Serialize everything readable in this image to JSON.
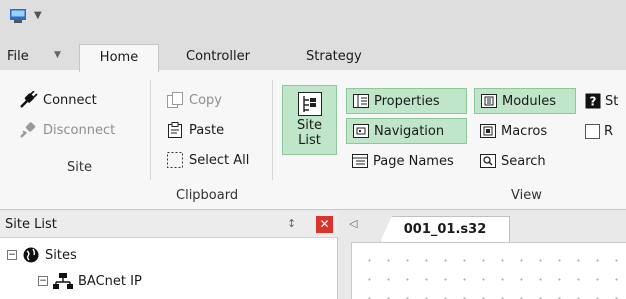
{
  "menu": {
    "file_label": "File",
    "tabs": [
      "Home",
      "Controller",
      "Strategy"
    ]
  },
  "ribbon": {
    "site": {
      "connect": "Connect",
      "disconnect": "Disconnect",
      "label": "Site"
    },
    "clipboard": {
      "copy": "Copy",
      "paste": "Paste",
      "select_all": "Select All",
      "label": "Clipboard"
    },
    "view": {
      "site_list": [
        "Site",
        "List"
      ],
      "properties": "Properties",
      "navigation": "Navigation",
      "page_names": "Page Names",
      "modules": "Modules",
      "macros": "Macros",
      "search": "Search",
      "st_partial": "St",
      "r_partial": "R",
      "label": "View"
    }
  },
  "site_list_panel": {
    "title": "Site List",
    "pin_glyph": "↕",
    "close_glyph": "✕",
    "tree": [
      {
        "label": "Sites",
        "expander": "−"
      },
      {
        "label": "BACnet IP",
        "expander": "−"
      }
    ]
  },
  "document": {
    "tab_label": "001_01.s32"
  },
  "colors": {
    "active_green": "#bfe6c8",
    "active_green_border": "#8fc79b",
    "close_red": "#d9342b"
  }
}
